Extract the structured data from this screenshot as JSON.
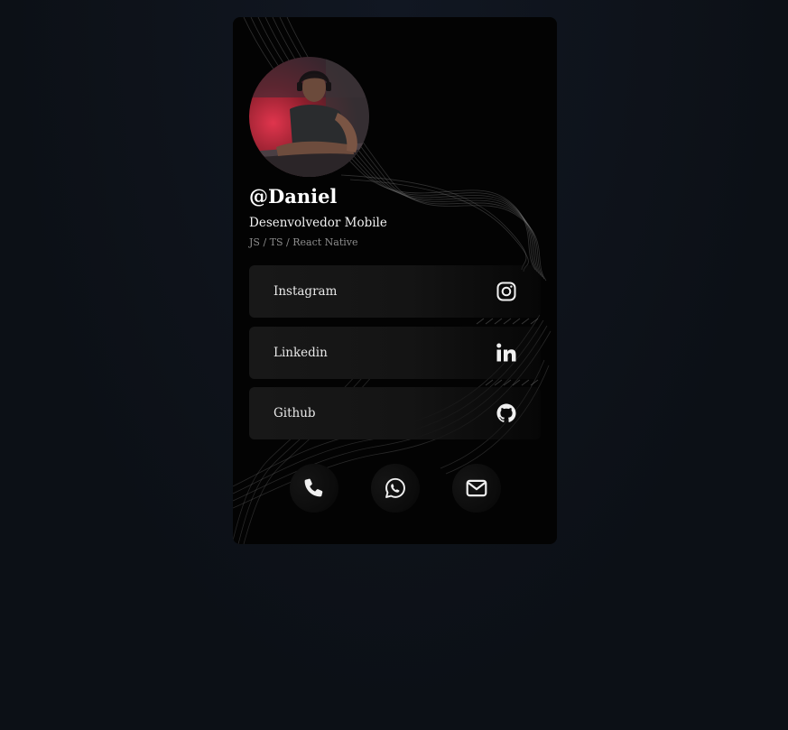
{
  "profile": {
    "username": "@Daniel",
    "role": "Desenvolvedor Mobile",
    "stack": "JS / TS / React Native",
    "avatar_icon": "profile-photo"
  },
  "links": [
    {
      "label": "Instagram",
      "icon": "instagram-icon"
    },
    {
      "label": "Linkedin",
      "icon": "linkedin-icon"
    },
    {
      "label": "Github",
      "icon": "github-icon"
    }
  ],
  "contacts": [
    {
      "icon": "phone-icon"
    },
    {
      "icon": "whatsapp-icon"
    },
    {
      "icon": "mail-icon"
    }
  ],
  "colors": {
    "page_background": "#0d1117",
    "card_background": "#030303",
    "button_background": "#181818",
    "text_primary": "#ffffff",
    "text_muted": "#8d8d8d"
  }
}
